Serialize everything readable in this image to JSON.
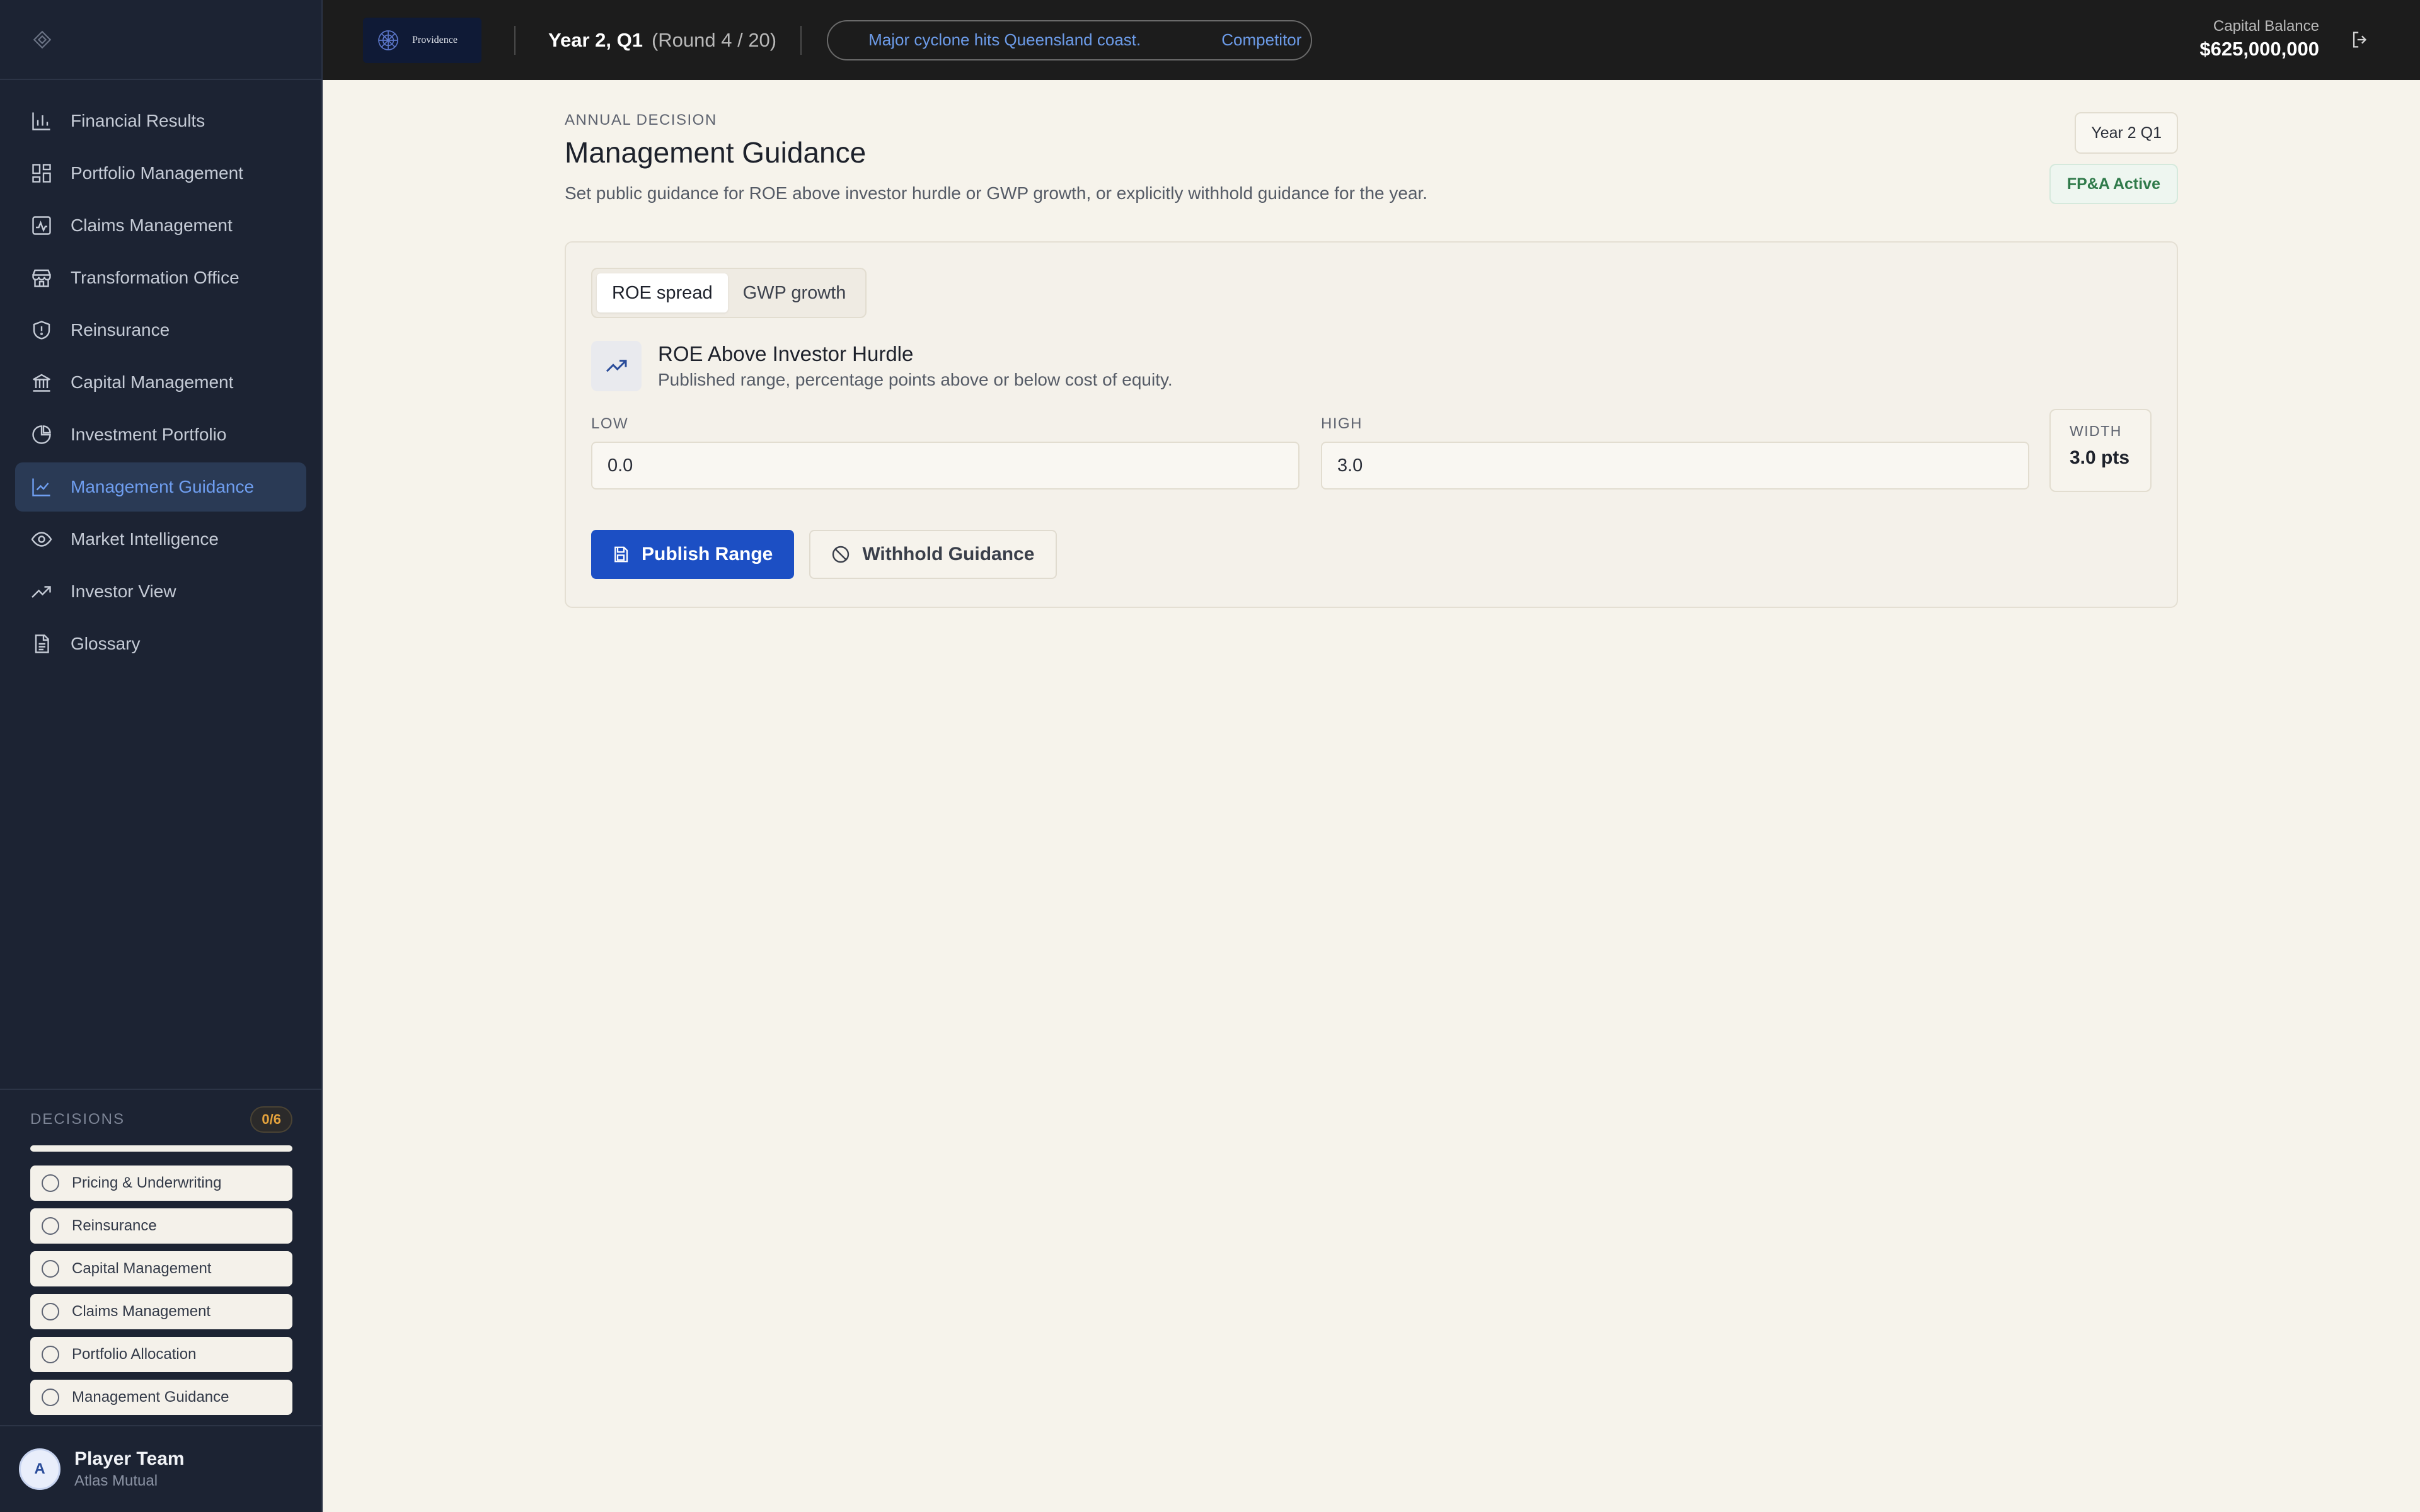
{
  "sidebar": {
    "logo_icon": "diamond-logo-icon",
    "nav": [
      {
        "label": "Financial Results",
        "icon": "bar-chart-icon",
        "active": false
      },
      {
        "label": "Portfolio Management",
        "icon": "grid-icon",
        "active": false
      },
      {
        "label": "Claims Management",
        "icon": "activity-icon",
        "active": false
      },
      {
        "label": "Transformation Office",
        "icon": "store-icon",
        "active": false
      },
      {
        "label": "Reinsurance",
        "icon": "shield-icon",
        "active": false
      },
      {
        "label": "Capital Management",
        "icon": "bank-icon",
        "active": false
      },
      {
        "label": "Investment Portfolio",
        "icon": "pie-chart-icon",
        "active": false
      },
      {
        "label": "Management Guidance",
        "icon": "line-chart-icon",
        "active": true
      },
      {
        "label": "Market Intelligence",
        "icon": "eye-icon",
        "active": false
      },
      {
        "label": "Investor View",
        "icon": "trending-up-icon",
        "active": false
      },
      {
        "label": "Glossary",
        "icon": "document-icon",
        "active": false
      }
    ],
    "decisions": {
      "title": "DECISIONS",
      "count": "0/6",
      "progress": 0,
      "items": [
        "Pricing & Underwriting",
        "Reinsurance",
        "Capital Management",
        "Claims Management",
        "Portfolio Allocation",
        "Management Guidance"
      ]
    },
    "player": {
      "initial": "A",
      "name": "Player Team",
      "org": "Atlas Mutual"
    }
  },
  "topbar": {
    "brand": "Providence",
    "round_main": "Year 2, Q1",
    "round_sub": "(Round 4 / 20)",
    "ticker": [
      "Major cyclone hits Queensland coast.",
      "Competitor"
    ],
    "capital_label": "Capital Balance",
    "capital_value": "$625,000,000"
  },
  "main": {
    "eyebrow": "ANNUAL DECISION",
    "title": "Management Guidance",
    "description": "Set public guidance for ROE above investor hurdle or GWP growth, or explicitly withhold guidance for the year.",
    "badge_year": "Year 2 Q1",
    "badge_status": "FP&A Active",
    "tabs": [
      {
        "label": "ROE spread",
        "active": true
      },
      {
        "label": "GWP growth",
        "active": false
      }
    ],
    "section_title": "ROE Above Investor Hurdle",
    "section_sub": "Published range, percentage points above or below cost of equity.",
    "low_label": "LOW",
    "low_value": "0.0",
    "high_label": "HIGH",
    "high_value": "3.0",
    "width_label": "WIDTH",
    "width_value": "3.0 pts",
    "publish_label": "Publish Range",
    "withhold_label": "Withhold Guidance"
  },
  "colors": {
    "accent": "#1c4fc4",
    "sidebar_bg": "#1c2333",
    "page_bg": "#f6f3eb",
    "ticker_text": "#6c9be8",
    "status_green": "#2f7a4a",
    "warning": "#e4a23c"
  }
}
